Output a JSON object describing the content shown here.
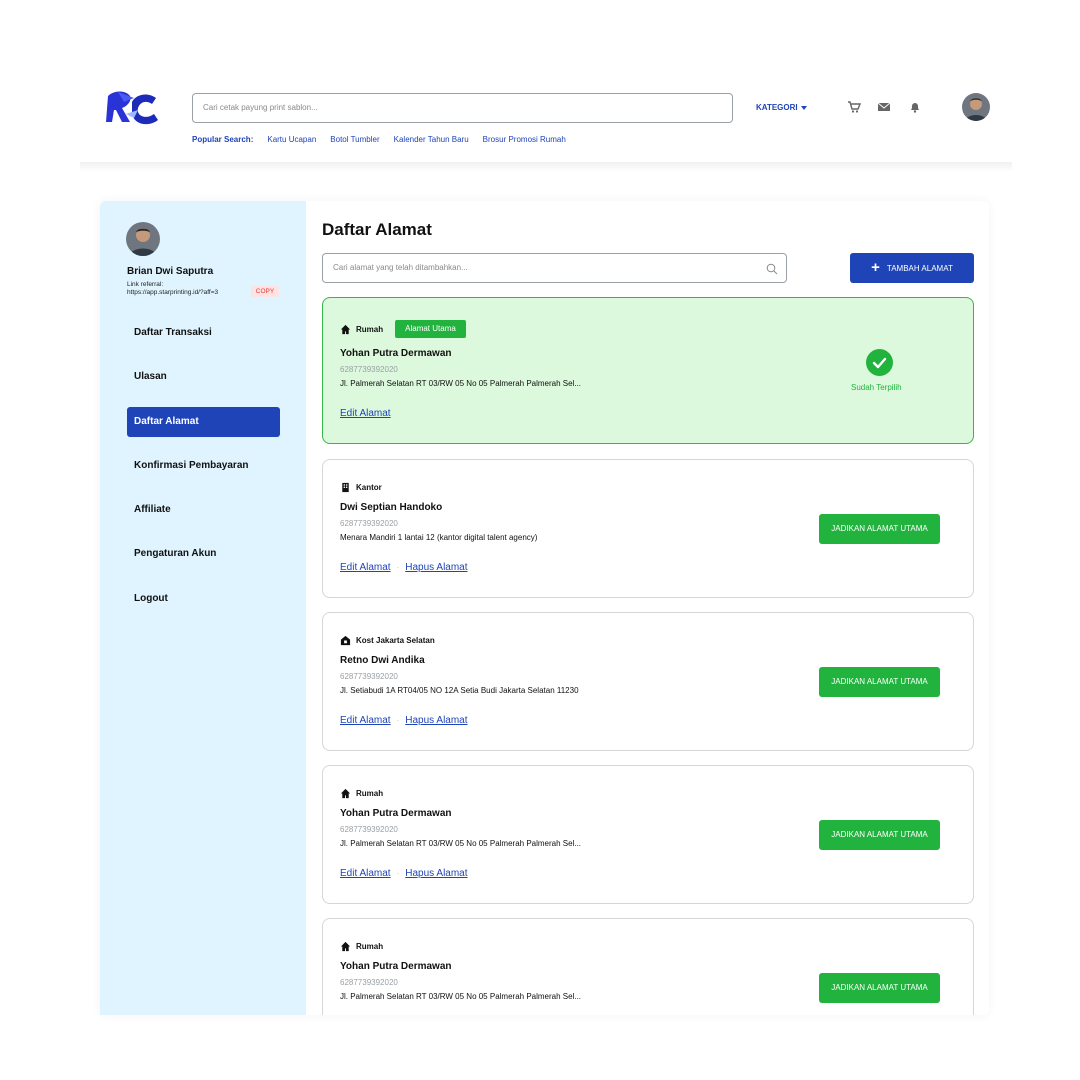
{
  "header": {
    "search_placeholder": "Cari cetak payung print sablon...",
    "kategori_label": "KATEGORI",
    "popular_label": "Popular Search:",
    "popular_tags": [
      "Kartu Ucapan",
      "Botol Tumbler",
      "Kalender Tahun Baru",
      "Brosur Promosi Rumah"
    ],
    "icons": [
      "cart-icon",
      "mail-icon",
      "bell-icon"
    ]
  },
  "user": {
    "name": "Brian Dwi Saputra",
    "referral_label": "Link referral:",
    "referral_link": "https://app.starprinting.id/?aff=3",
    "copy_label": "COPY"
  },
  "sidebar": {
    "items": [
      {
        "label": "Daftar Transaksi",
        "active": false
      },
      {
        "label": "Ulasan",
        "active": false
      },
      {
        "label": "Daftar Alamat",
        "active": true
      },
      {
        "label": "Konfirmasi Pembayaran",
        "active": false
      },
      {
        "label": "Affiliate",
        "active": false
      },
      {
        "label": "Pengaturan Akun",
        "active": false
      },
      {
        "label": "Logout",
        "active": false
      }
    ]
  },
  "main": {
    "title": "Daftar Alamat",
    "search_placeholder": "Cari alamat yang telah ditambahkan...",
    "add_button": "TAMBAH ALAMAT",
    "primary_badge": "Alamat Utama",
    "selected_label": "Sudah Terpilih",
    "set_primary_label": "JADIKAN ALAMAT UTAMA",
    "edit_label": "Edit Alamat",
    "delete_label": "Hapus Alamat",
    "addresses": [
      {
        "type": "Rumah",
        "icon": "home-icon",
        "name": "Yohan Putra Dermawan",
        "phone": "6287739392020",
        "address": "Jl. Palmerah Selatan RT 03/RW 05 No 05 Palmerah Palmerah Sel...",
        "primary": true
      },
      {
        "type": "Kantor",
        "icon": "building-icon",
        "name": "Dwi Septian Handoko",
        "phone": "6287739392020",
        "address": "Menara Mandiri 1 lantai 12 (kantor digital talent agency)",
        "primary": false
      },
      {
        "type": "Kost Jakarta Selatan",
        "icon": "house-box-icon",
        "name": "Retno Dwi Andika",
        "phone": "6287739392020",
        "address": "Jl. Setiabudi 1A RT04/05 NO 12A Setia Budi Jakarta Selatan 11230",
        "primary": false
      },
      {
        "type": "Rumah",
        "icon": "home-icon",
        "name": "Yohan Putra Dermawan",
        "phone": "6287739392020",
        "address": "Jl. Palmerah Selatan RT 03/RW 05 No 05 Palmerah Palmerah Sel...",
        "primary": false
      },
      {
        "type": "Rumah",
        "icon": "home-icon",
        "name": "Yohan Putra Dermawan",
        "phone": "6287739392020",
        "address": "Jl. Palmerah Selatan RT 03/RW 05 No 05 Palmerah Palmerah Sel...",
        "primary": false
      }
    ]
  },
  "colors": {
    "brand_blue": "#1e44b8",
    "success_green": "#22b33f",
    "sidebar_bg": "#dff4ff",
    "primary_card_bg": "#dcf8dd"
  }
}
